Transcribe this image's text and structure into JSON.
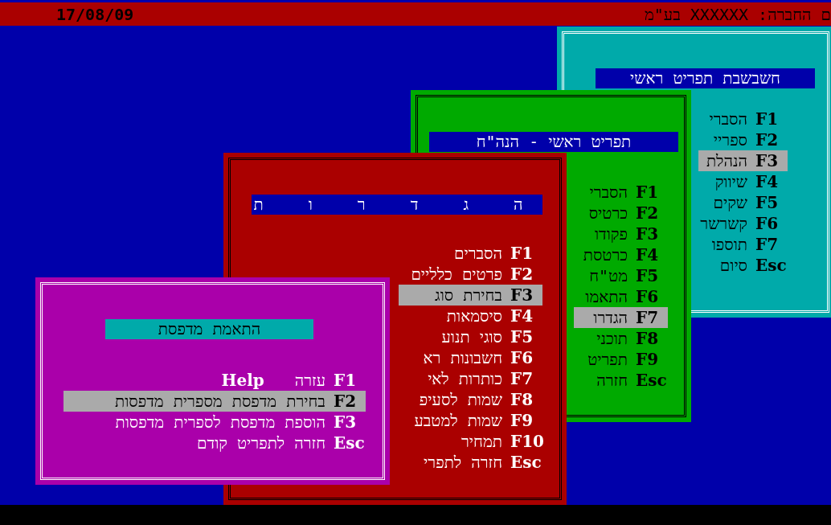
{
  "top_bar": {
    "date": "17/08/09",
    "company": "ם החברה: XXXXXX בע\"מ"
  },
  "windows": [
    {
      "title": "חשבשבת תפריט ראשי",
      "color": "#00aaaa",
      "items": [
        {
          "key": "F1",
          "label": "הסברי",
          "selected": false
        },
        {
          "key": "F2",
          "label": "ספריי",
          "selected": false
        },
        {
          "key": "F3",
          "label": "הנהלת",
          "selected": true
        },
        {
          "key": "F4",
          "label": "שיווק",
          "selected": false
        },
        {
          "key": "F5",
          "label": "שקים",
          "selected": false
        },
        {
          "key": "F6",
          "label": "קשרשר",
          "selected": false
        },
        {
          "key": "F7",
          "label": "תוספו",
          "selected": false
        },
        {
          "key": "Esc",
          "label": "סיום",
          "selected": false
        }
      ]
    },
    {
      "title": "תפריט ראשי - הנה\"ח",
      "color": "#00aa00",
      "items": [
        {
          "key": "F1",
          "label": "הסברי",
          "selected": false
        },
        {
          "key": "F2",
          "label": "כרטיס",
          "selected": false
        },
        {
          "key": "F3",
          "label": "פקודו",
          "selected": false
        },
        {
          "key": "F4",
          "label": "כרטסת",
          "selected": false
        },
        {
          "key": "F5",
          "label": "מט\"ח",
          "selected": false
        },
        {
          "key": "F6",
          "label": "התאמו",
          "selected": false
        },
        {
          "key": "F7",
          "label": "הגדרו",
          "selected": true
        },
        {
          "key": "F8",
          "label": "תוכני",
          "selected": false
        },
        {
          "key": "F9",
          "label": "תפריט",
          "selected": false
        },
        {
          "key": "Esc",
          "label": "חזרה",
          "selected": false
        }
      ]
    },
    {
      "title": "ה ג ד ר ו ת",
      "color": "#aa0000",
      "items": [
        {
          "key": "F1",
          "label": "הסברים",
          "selected": false
        },
        {
          "key": "F2",
          "label": "פרטים כלליים",
          "selected": false
        },
        {
          "key": "F3",
          "label": "בחירת סוג",
          "selected": true
        },
        {
          "key": "F4",
          "label": "סיסמאות",
          "selected": false
        },
        {
          "key": "F5",
          "label": "סוגי תנוע",
          "selected": false
        },
        {
          "key": "F6",
          "label": "חשבונות רא",
          "selected": false
        },
        {
          "key": "F7",
          "label": "כותרות לאי",
          "selected": false
        },
        {
          "key": "F8",
          "label": "שמות לסעיפ",
          "selected": false
        },
        {
          "key": "F9",
          "label": "שמות למטבע",
          "selected": false
        },
        {
          "key": "F10",
          "label": "תמחיר",
          "selected": false
        },
        {
          "key": "Esc",
          "label": "חזרה לתפרי",
          "selected": false
        }
      ]
    },
    {
      "title": "התאמת מדפסת",
      "color": "#aa00aa",
      "items": [
        {
          "key": "F1",
          "label": "עזרה",
          "extra": "Help",
          "selected": false
        },
        {
          "key": "F2",
          "label": "בחירת מדפסת מספרית מדפסות",
          "selected": true
        },
        {
          "key": "F3",
          "label": "הוספת מדפסת לספרית מדפסות",
          "selected": false
        },
        {
          "key": "Esc",
          "label": "חזרה לתפריט קודם",
          "selected": false
        }
      ]
    }
  ]
}
